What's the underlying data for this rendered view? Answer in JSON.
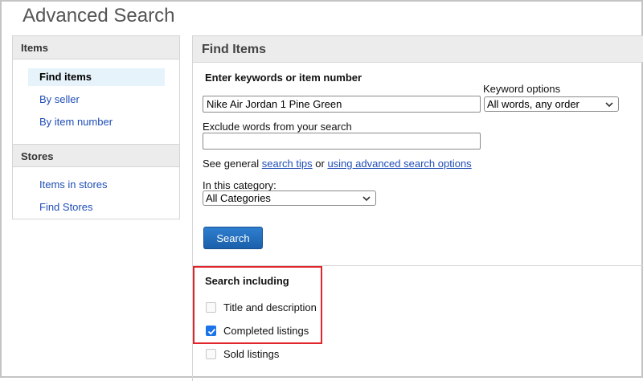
{
  "page": {
    "title": "Advanced Search"
  },
  "sidebar": {
    "sections": [
      {
        "heading": "Items",
        "items": [
          {
            "label": "Find items",
            "active": true
          },
          {
            "label": "By seller"
          },
          {
            "label": "By item number"
          }
        ]
      },
      {
        "heading": "Stores",
        "items": [
          {
            "label": "Items in stores"
          },
          {
            "label": "Find Stores"
          }
        ]
      }
    ]
  },
  "main": {
    "heading": "Find Items",
    "keywords": {
      "label": "Enter keywords or item number",
      "value": "Nike Air Jordan 1 Pine Green"
    },
    "keyword_options": {
      "label": "Keyword options",
      "selected": "All words, any order"
    },
    "exclude": {
      "label": "Exclude words from your search",
      "value": ""
    },
    "tips": {
      "prefix": "See general",
      "link1": "search tips",
      "middle": "or",
      "link2": "using advanced search options"
    },
    "category": {
      "label": "In this category:",
      "selected": "All Categories"
    },
    "search_button": "Search",
    "search_including": {
      "heading": "Search including",
      "options": [
        {
          "label": "Title and description",
          "checked": false
        },
        {
          "label": "Completed listings",
          "checked": true
        },
        {
          "label": "Sold listings",
          "checked": false
        }
      ]
    }
  },
  "colors": {
    "link": "#1f4db6",
    "button": "#1b5faa",
    "highlight": "#e0252b",
    "checkbox": "#1a73e8"
  }
}
